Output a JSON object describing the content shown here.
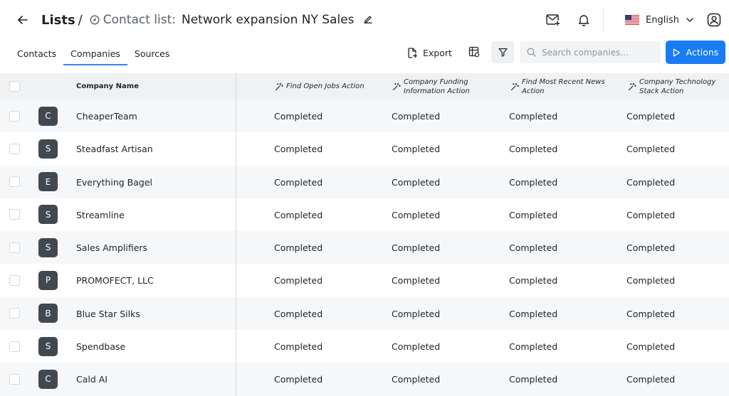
{
  "header": {
    "breadcrumb_root": "Lists",
    "breadcrumb_sep": "/",
    "list_type": "Contact list:",
    "list_name": "Network expansion NY Sales",
    "language": "English"
  },
  "tabs": [
    {
      "label": "Contacts",
      "active": false
    },
    {
      "label": "Companies",
      "active": true
    },
    {
      "label": "Sources",
      "active": false
    }
  ],
  "toolbar": {
    "export_label": "Export",
    "search_placeholder": "Search companies...",
    "actions_label": "Actions"
  },
  "table": {
    "columns": [
      "Company Name",
      "Find Open Jobs Action",
      "Company Funding Information Action",
      "Find Most Recent News Action",
      "Company Technology Stack Action"
    ],
    "rows": [
      {
        "initial": "C",
        "name": "CheaperTeam",
        "jobs": "Completed",
        "funding": "Completed",
        "news": "Completed",
        "tech": "Completed"
      },
      {
        "initial": "S",
        "name": "Steadfast Artisan",
        "jobs": "Completed",
        "funding": "Completed",
        "news": "Completed",
        "tech": "Completed"
      },
      {
        "initial": "E",
        "name": "Everything Bagel",
        "jobs": "Completed",
        "funding": "Completed",
        "news": "Completed",
        "tech": "Completed"
      },
      {
        "initial": "S",
        "name": "Streamline",
        "jobs": "Completed",
        "funding": "Completed",
        "news": "Completed",
        "tech": "Completed"
      },
      {
        "initial": "S",
        "name": "Sales Amplifiers",
        "jobs": "Completed",
        "funding": "Completed",
        "news": "Completed",
        "tech": "Completed"
      },
      {
        "initial": "P",
        "name": "PROMOFECT, LLC",
        "jobs": "Completed",
        "funding": "Completed",
        "news": "Completed",
        "tech": "Completed"
      },
      {
        "initial": "B",
        "name": "Blue Star Silks",
        "jobs": "Completed",
        "funding": "Completed",
        "news": "Completed",
        "tech": "Completed"
      },
      {
        "initial": "S",
        "name": "Spendbase",
        "jobs": "Completed",
        "funding": "Completed",
        "news": "Completed",
        "tech": "Completed"
      },
      {
        "initial": "C",
        "name": "Cald AI",
        "jobs": "Completed",
        "funding": "Completed",
        "news": "Completed",
        "tech": "Completed"
      }
    ]
  },
  "colors": {
    "accent": "#1a7cf2",
    "tab_underline": "#3b82f6",
    "avatar_bg": "#424850"
  },
  "icons": {
    "back": "arrow-left-icon",
    "list": "compass-icon",
    "edit": "pencil-icon",
    "mail": "mail-plus-icon",
    "bell": "bell-icon",
    "flag": "us-flag-icon",
    "chevron": "chevron-down-icon",
    "user": "user-circle-icon",
    "export": "file-export-icon",
    "columns": "table-settings-icon",
    "filter": "filter-icon",
    "search": "search-icon",
    "play": "play-icon",
    "wand": "magic-wand-icon"
  }
}
